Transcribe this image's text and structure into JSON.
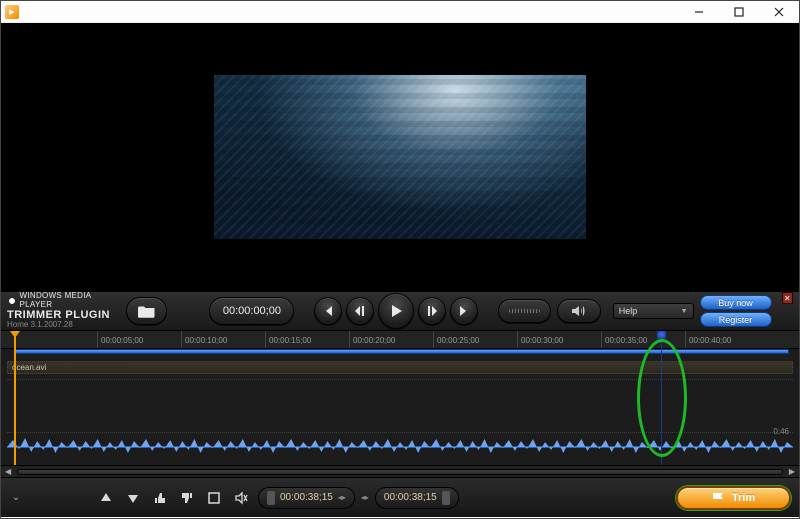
{
  "player": {
    "brand": "WINDOWS MEDIA PLAYER",
    "plugin": "TRIMMER PLUGIN",
    "version": "Home 3.1.2007.28"
  },
  "controls": {
    "timecode": "00:00:00;00",
    "play_label": "Play",
    "prev_label": "Previous",
    "step_back_label": "Step Back",
    "step_fwd_label": "Step Forward",
    "next_label": "Next"
  },
  "help": {
    "label": "Help"
  },
  "buttons": {
    "buy": "Buy now",
    "register": "Register",
    "trim": "Trim"
  },
  "timeline": {
    "clip_name": "ocean.avi",
    "duration_label": "0:46",
    "ticks": [
      "00:00:05;00",
      "00:00:10;00",
      "00:00:15;00",
      "00:00:20;00",
      "00:00:25;00",
      "00:00:30;00",
      "00:00:35;00",
      "00:00:40;00"
    ]
  },
  "footer": {
    "in_tc": "00:00:38;15",
    "out_tc": "00:00:38;15"
  }
}
